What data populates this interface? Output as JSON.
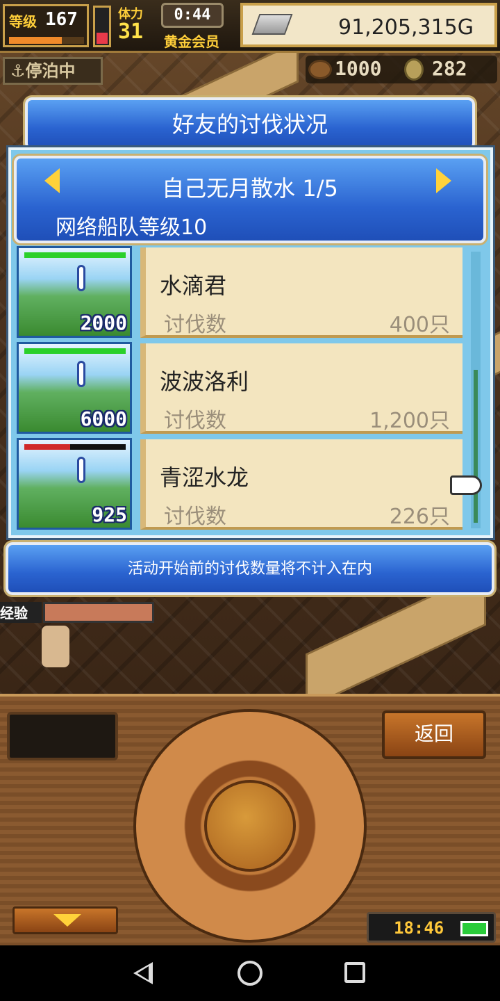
{
  "hud": {
    "level_label": "等级",
    "level_value": "167",
    "stamina_label": "体力",
    "stamina_value": "31",
    "timer": "0:44",
    "membership": "黄金会员",
    "gold": "91,205,315G",
    "status": "停泊中",
    "resource1": "1000",
    "resource2": "282"
  },
  "dialog": {
    "title": "好友的讨伐状况",
    "subtitle": "自己无月散水 1/5",
    "fleet_level": "网络船队等级10",
    "note": "活动开始前的讨伐数量将不计入在内"
  },
  "entries": [
    {
      "name": "水滴君",
      "label": "讨伐数",
      "value": "400只",
      "badge": "2000",
      "hp": 1.0,
      "hp_color": "#2ad02a"
    },
    {
      "name": "波波洛利",
      "label": "讨伐数",
      "value": "1,200只",
      "badge": "6000",
      "hp": 1.0,
      "hp_color": "#2ad02a"
    },
    {
      "name": "青涩水龙",
      "label": "讨伐数",
      "value": "226只",
      "badge": "925",
      "hp": 0.45,
      "hp_color": "#d02a2a"
    }
  ],
  "console": {
    "back_label": "返回",
    "clock": "18:46"
  },
  "scene": {
    "character_tag": "经验"
  }
}
